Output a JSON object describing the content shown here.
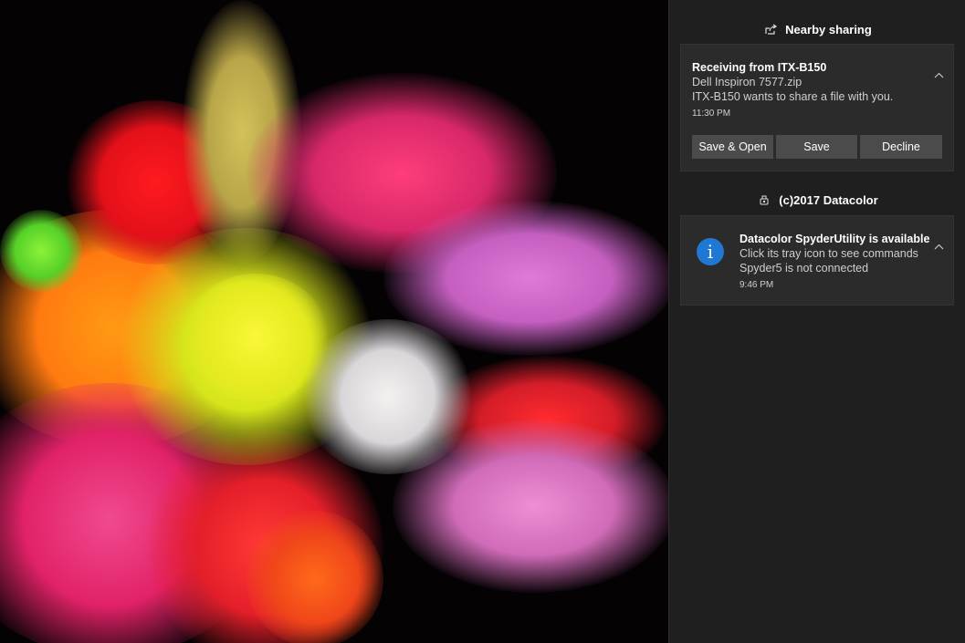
{
  "notifications": {
    "sharing_group": {
      "header": "Nearby sharing",
      "icon": "share-icon",
      "toast": {
        "title": "Receiving from ITX-B150",
        "filename": "Dell Inspiron 7577.zip",
        "message": "ITX-B150 wants to share a file with you.",
        "time": "11:30 PM",
        "buttons": {
          "save_open": "Save & Open",
          "save": "Save",
          "decline": "Decline"
        }
      }
    },
    "datacolor_group": {
      "header": "(c)2017 Datacolor",
      "icon": "datacolor-app-icon",
      "toast": {
        "title": "Datacolor SpyderUtility is available",
        "line1": "Click its tray icon to see commands",
        "line2": "Spyder5 is not connected",
        "time": "9:46 PM",
        "icon": "info-icon",
        "icon_glyph": "i",
        "icon_color": "#1f78d1"
      }
    }
  },
  "colors": {
    "panel_bg": "#1f1f1f",
    "toast_bg": "#2b2b2b",
    "button_bg": "#4b4b4b",
    "text_secondary": "#cfcfcf"
  }
}
